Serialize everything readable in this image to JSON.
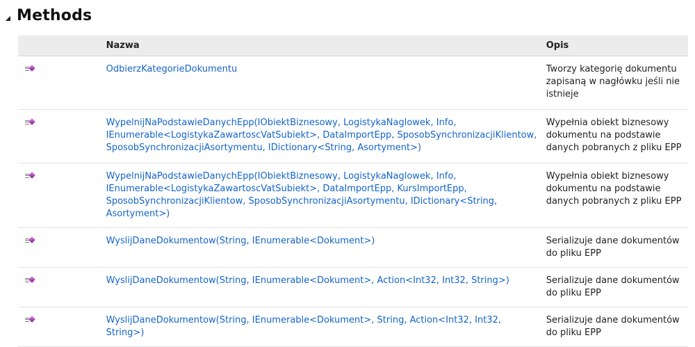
{
  "section": {
    "title": "Methods"
  },
  "table": {
    "headers": {
      "icon": "",
      "name": "Nazwa",
      "description": "Opis"
    },
    "rows": [
      {
        "icon": "public-method-icon",
        "name": "OdbierzKategorieDokumentu",
        "description": "Tworzy kategorię dokumentu zapisaną w nagłówku jeśli nie istnieje"
      },
      {
        "icon": "public-method-icon",
        "name": "WypelnijNaPodstawieDanychEpp(IObiektBiznesowy, LogistykaNaglowek, Info, IEnumerable<LogistykaZawartoscVatSubiekt>, DataImportEpp, SposobSynchronizacjiKlientow, SposobSynchronizacjiAsortymentu, IDictionary<String, Asortyment>)",
        "description": "Wypełnia obiekt biznesowy dokumentu na podstawie danych pobranych z pliku EPP"
      },
      {
        "icon": "public-method-icon",
        "name": "WypelnijNaPodstawieDanychEpp(IObiektBiznesowy, LogistykaNaglowek, Info, IEnumerable<LogistykaZawartoscVatSubiekt>, DataImportEpp, KursImportEpp, SposobSynchronizacjiKlientow, SposobSynchronizacjiAsortymentu, IDictionary<String, Asortyment>)",
        "description": "Wypełnia obiekt biznesowy dokumentu na podstawie danych pobranych z pliku EPP"
      },
      {
        "icon": "public-method-icon",
        "name": "WyslijDaneDokumentow(String, IEnumerable<Dokument>)",
        "description": "Serializuje dane dokumentów do pliku EPP"
      },
      {
        "icon": "public-method-icon",
        "name": "WyslijDaneDokumentow(String, IEnumerable<Dokument>, Action<Int32, Int32, String>)",
        "description": "Serializuje dane dokumentów do pliku EPP"
      },
      {
        "icon": "public-method-icon",
        "name": "WyslijDaneDokumentow(String, IEnumerable<Dokument>, String, Action<Int32, Int32, String>)",
        "description": "Serializuje dane dokumentów do pliku EPP"
      }
    ]
  },
  "colors": {
    "link": "#1364c8",
    "header_bg": "#ececec",
    "method_icon": "#a640b4"
  }
}
